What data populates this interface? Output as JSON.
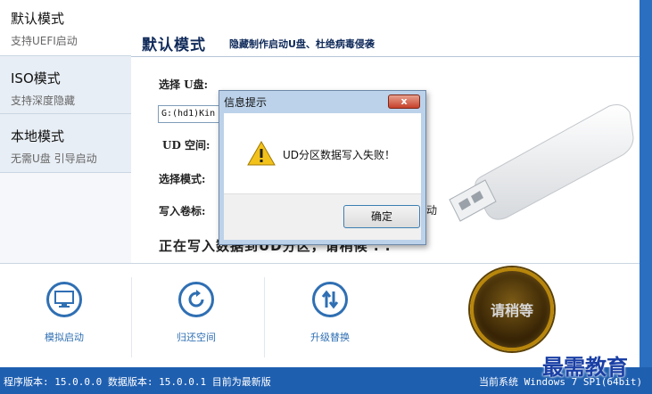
{
  "sidebar": {
    "items": [
      {
        "title": "默认模式",
        "subtitle": "支持UEFI启动"
      },
      {
        "title": "ISO模式",
        "subtitle": "支持深度隐藏"
      },
      {
        "title": "本地模式",
        "subtitle": "无需U盘 引导启动"
      }
    ]
  },
  "header": {
    "title": "默认模式",
    "subtitle": "隐藏制作启动U盘、杜绝病毒侵袭"
  },
  "form": {
    "select_u_label": "选择 U盘:",
    "u_drive_value": "G:(hd1)Kin",
    "ud_space_label": "UD 空间:",
    "mode_label": "选择模式:",
    "volume_label": "写入卷标:",
    "trailing_text": "动",
    "progress_text": "正在写入数据到UD分区，请稍候 . ."
  },
  "dialog": {
    "title": "信息提示",
    "close_label": "x",
    "message": "UD分区数据写入失败！",
    "ok_label": "确定"
  },
  "toolbar": {
    "buttons": [
      {
        "label": "模拟启动"
      },
      {
        "label": "归还空间"
      },
      {
        "label": "升级替换"
      }
    ],
    "wait_label": "请稍等"
  },
  "status": {
    "left": "程序版本: 15.0.0.0 数据版本: 15.0.0.1 目前为最新版",
    "right": "当前系统 Windows 7 SP1(64bit)"
  },
  "watermark": "最需教育",
  "colors": {
    "accent": "#2f6fb3",
    "status_bar": "#1f5fb0",
    "title_text": "#0f2a5a"
  }
}
